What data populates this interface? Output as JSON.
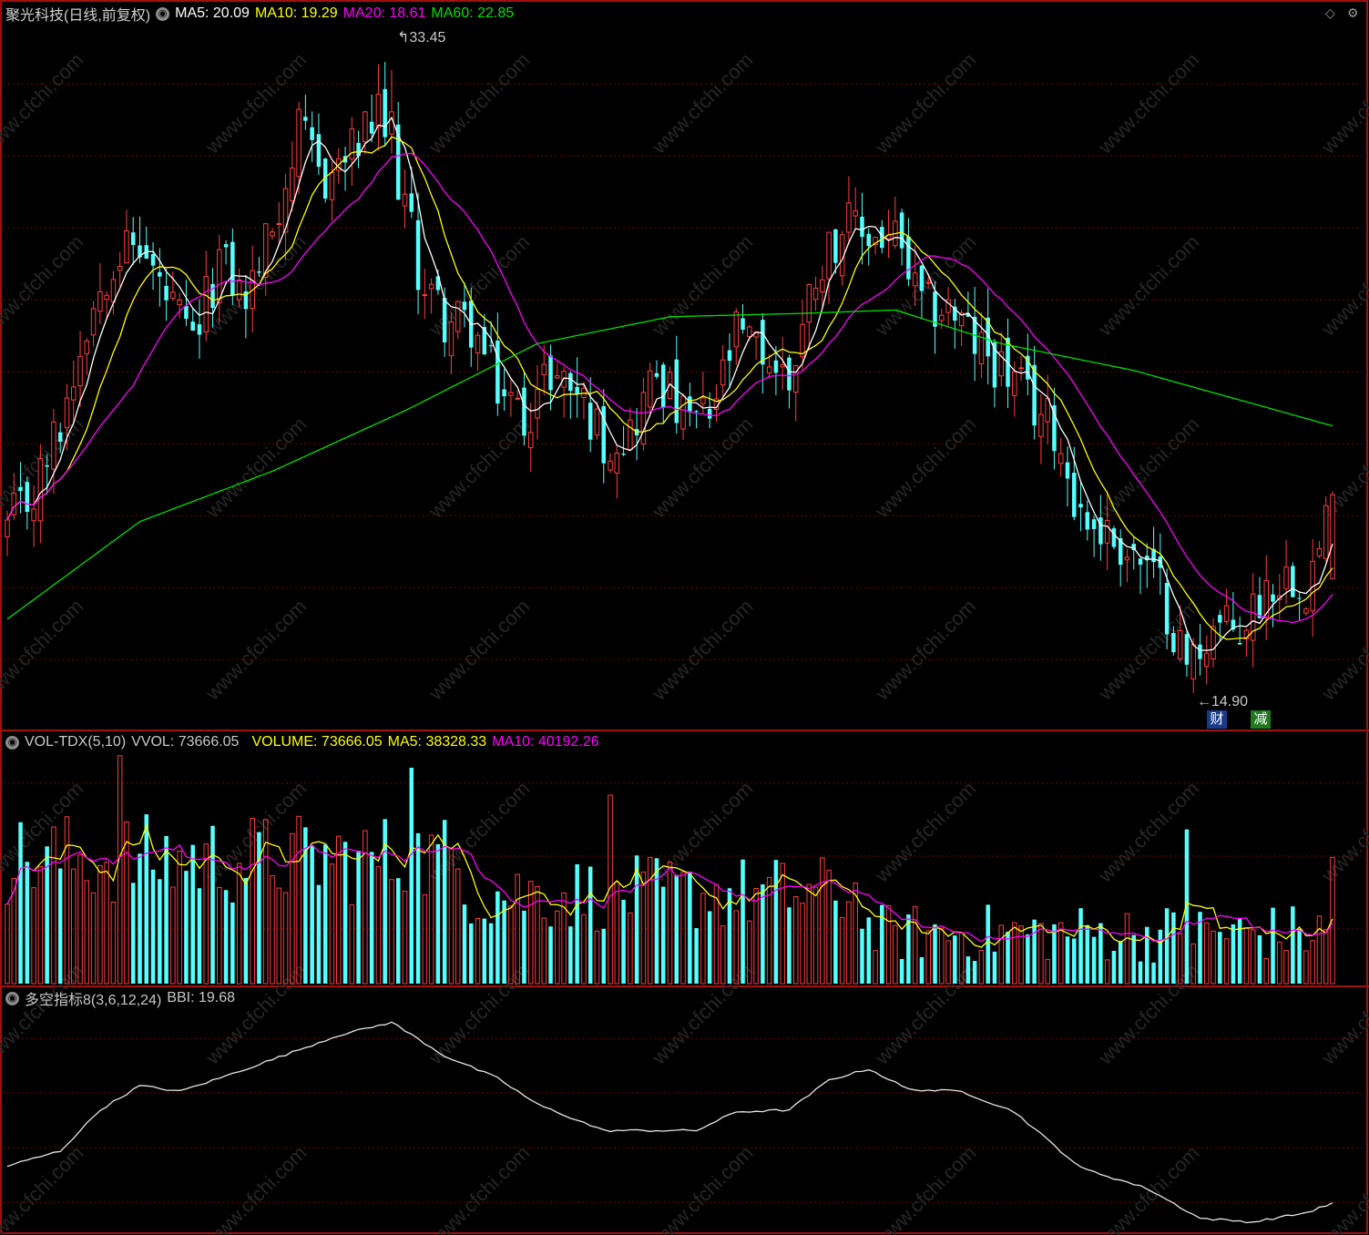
{
  "colors": {
    "up": "#ff3c3c",
    "down": "#54ffff",
    "ma5": "#ffffff",
    "ma10": "#ffff00",
    "ma20": "#ff00ff",
    "ma60": "#00e000",
    "frame": "#a01010",
    "grid": "#7a0000"
  },
  "header": {
    "title": "聚光科技(日线,前复权)",
    "ma5": "MA5: 20.09",
    "ma10": "MA10: 19.29",
    "ma20": "MA20: 18.61",
    "ma60": "MA60: 22.85"
  },
  "volume_header": {
    "name": "VOL-TDX(5,10)",
    "vvol": "VVOL: 73666.05",
    "volume": "VOLUME: 73666.05",
    "ma5": "MA5: 38328.33",
    "ma10": "MA10: 40192.26"
  },
  "bbi_header": {
    "name": "多空指标8(3,6,12,24)",
    "bbi": "BBI: 19.68"
  },
  "annotations": {
    "high": "33.45",
    "low": "14.90",
    "badge_cai": "财",
    "badge_jian": "减"
  },
  "chart_data": [
    {
      "type": "candlestick",
      "series": [
        {
          "name": "MA5",
          "value": 20.09
        },
        {
          "name": "MA10",
          "value": 19.29
        },
        {
          "name": "MA20",
          "value": 18.61
        },
        {
          "name": "MA60",
          "value": 22.85
        }
      ],
      "ohlc_anchor": [
        [
          0,
          19.8
        ],
        [
          4,
          20.8
        ],
        [
          8,
          22.9
        ],
        [
          12,
          26.0
        ],
        [
          16,
          28.0
        ],
        [
          20,
          28.2
        ],
        [
          24,
          26.6
        ],
        [
          28,
          25.2
        ],
        [
          32,
          27.8
        ],
        [
          36,
          26.6
        ],
        [
          40,
          28.8
        ],
        [
          44,
          31.5
        ],
        [
          48,
          30.2
        ],
        [
          52,
          31.0
        ],
        [
          56,
          32.0
        ],
        [
          58,
          31.0
        ],
        [
          60,
          29.5
        ],
        [
          62,
          27.5
        ],
        [
          66,
          26.0
        ],
        [
          70,
          25.8
        ],
        [
          74,
          24.0
        ],
        [
          78,
          23.1
        ],
        [
          82,
          24.5
        ],
        [
          86,
          23.9
        ],
        [
          90,
          22.4
        ],
        [
          94,
          22.7
        ],
        [
          98,
          24.5
        ],
        [
          102,
          23.0
        ],
        [
          106,
          23.1
        ],
        [
          110,
          25.5
        ],
        [
          114,
          25.0
        ],
        [
          118,
          24.2
        ],
        [
          122,
          27.5
        ],
        [
          126,
          28.8
        ],
        [
          130,
          28.5
        ],
        [
          134,
          28.4
        ],
        [
          138,
          26.3
        ],
        [
          142,
          26.4
        ],
        [
          146,
          25.3
        ],
        [
          150,
          24.6
        ],
        [
          154,
          23.6
        ],
        [
          158,
          22.8
        ],
        [
          162,
          20.2
        ],
        [
          166,
          19.6
        ],
        [
          170,
          19.0
        ],
        [
          174,
          18.0
        ],
        [
          178,
          15.7
        ],
        [
          182,
          16.9
        ],
        [
          186,
          16.7
        ],
        [
          190,
          18.1
        ],
        [
          194,
          18.5
        ],
        [
          196,
          18.2
        ],
        [
          198,
          19.2
        ],
        [
          200,
          21.0
        ]
      ],
      "ylim": [
        14.0,
        34.5
      ],
      "high_label": "33.45",
      "low_label": "14.90",
      "bars": 201
    },
    {
      "type": "bar",
      "name": "VOLUME",
      "last_value": 73666.05,
      "series": [
        {
          "name": "MA5",
          "value": 38328.33
        },
        {
          "name": "MA10",
          "value": 40192.26
        }
      ],
      "ylim": [
        0,
        135000
      ]
    },
    {
      "type": "line",
      "name": "BBI",
      "last_value": 19.68,
      "anchors": [
        [
          0,
          19.0
        ],
        [
          8,
          19.8
        ],
        [
          14,
          22.0
        ],
        [
          20,
          23.3
        ],
        [
          26,
          23.0
        ],
        [
          32,
          23.7
        ],
        [
          40,
          24.7
        ],
        [
          50,
          26.0
        ],
        [
          58,
          26.7
        ],
        [
          66,
          24.9
        ],
        [
          74,
          23.7
        ],
        [
          80,
          22.3
        ],
        [
          90,
          20.9
        ],
        [
          98,
          20.9
        ],
        [
          104,
          20.9
        ],
        [
          110,
          21.9
        ],
        [
          118,
          22.0
        ],
        [
          124,
          23.6
        ],
        [
          130,
          24.2
        ],
        [
          136,
          23.1
        ],
        [
          144,
          23.0
        ],
        [
          152,
          21.9
        ],
        [
          162,
          18.9
        ],
        [
          172,
          17.8
        ],
        [
          180,
          16.2
        ],
        [
          188,
          16.0
        ],
        [
          196,
          16.5
        ],
        [
          200,
          17.0
        ]
      ],
      "ylim": [
        15.5,
        27.5
      ]
    }
  ]
}
